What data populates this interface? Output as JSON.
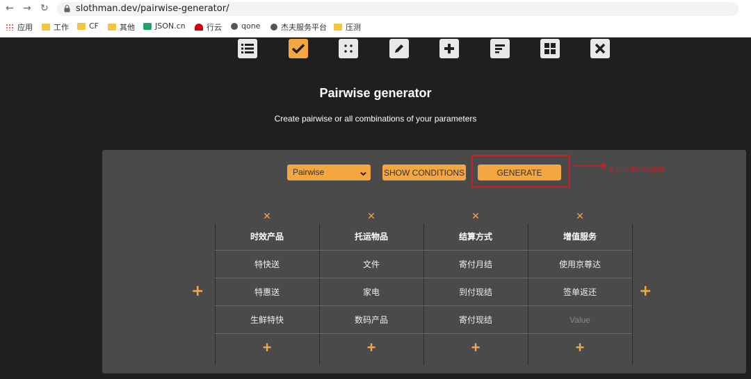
{
  "browser": {
    "url": "slothman.dev/pairwise-generator/",
    "bookmarks": [
      "应用",
      "工作",
      "CF",
      "其他",
      "JSON.cn",
      "行云",
      "qone",
      "杰夫服务平台",
      "压测"
    ]
  },
  "app": {
    "title": "Pairwise generator",
    "subtitle": "Create pairwise or all combinations of your parameters",
    "toolbar_icons": [
      "list-icon",
      "check-icon",
      "dice-icon",
      "edit-icon",
      "plus-icon",
      "align-icon",
      "grid-icon",
      "close-icon"
    ],
    "mode_select": {
      "value": "Pairwise"
    },
    "show_conditions_label": "SHOW CONDITIONS",
    "generate_label": "GENERATE",
    "annotation_text": "点击一下即可生成用例",
    "columns": [
      {
        "header": "时效产品",
        "values": [
          "特快送",
          "特惠送",
          "生鲜特快"
        ]
      },
      {
        "header": "托运物品",
        "values": [
          "文件",
          "家电",
          "数码产品"
        ]
      },
      {
        "header": "结算方式",
        "values": [
          "寄付月结",
          "到付现结",
          "寄付现结"
        ]
      },
      {
        "header": "增值服务",
        "values": [
          "使用京尊达",
          "签单返还",
          ""
        ]
      }
    ],
    "value_placeholder": "Value",
    "colors": {
      "accent": "#f4a640",
      "panel": "#4a4a4a",
      "background": "#1f1f1f",
      "annotation": "#d11d1d"
    }
  }
}
